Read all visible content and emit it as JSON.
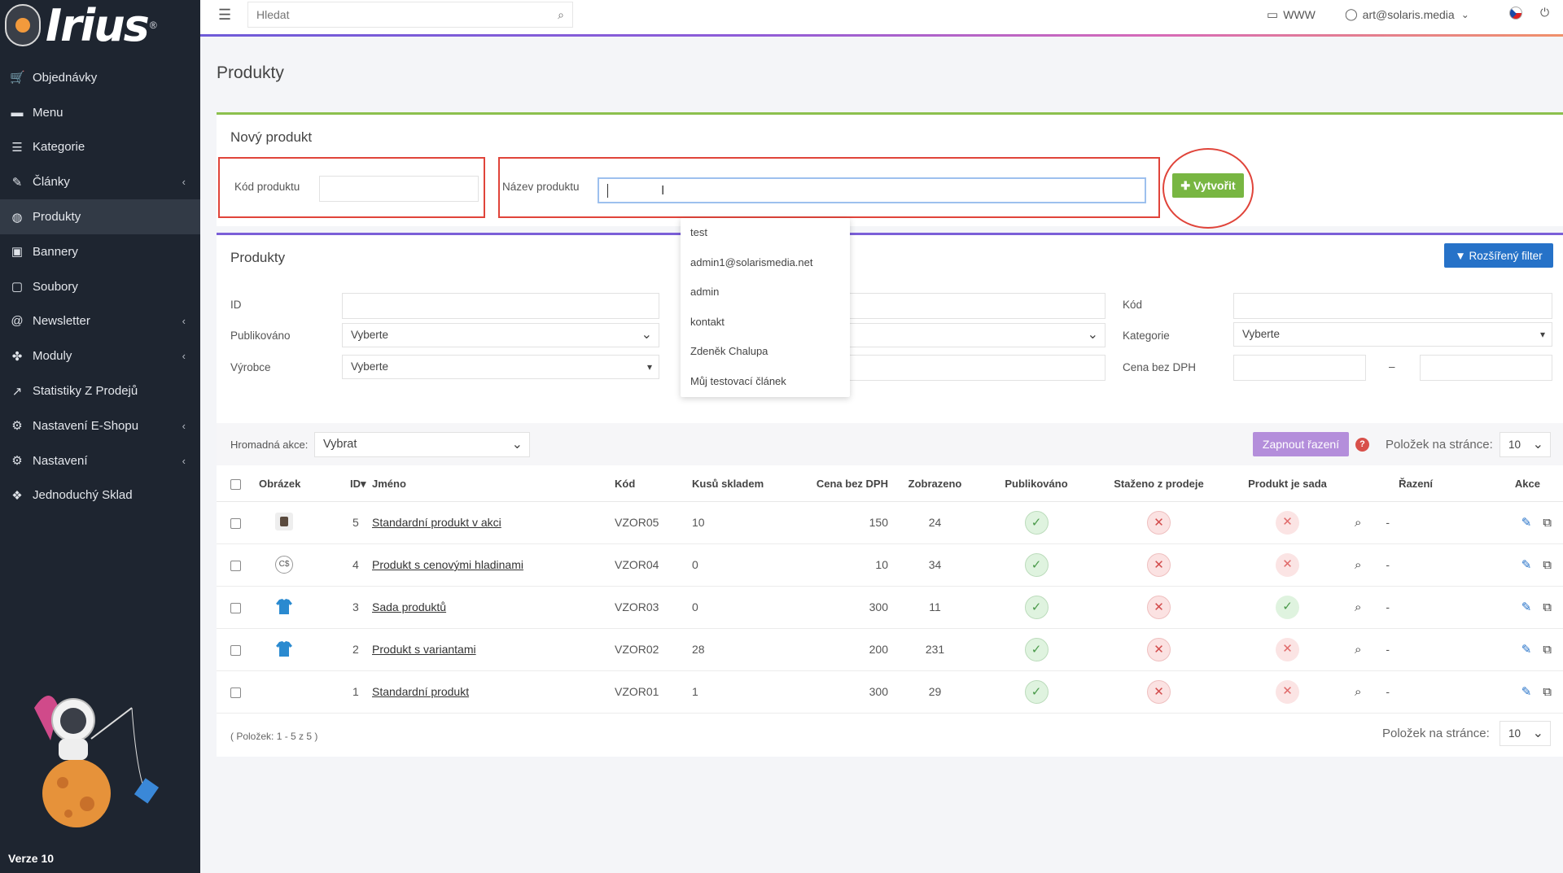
{
  "sidebar": {
    "logo_text": "Irius",
    "items": [
      {
        "label": "Objednávky",
        "icon": "cart-icon",
        "chevron": false
      },
      {
        "label": "Menu",
        "icon": "folder-icon",
        "chevron": false
      },
      {
        "label": "Kategorie",
        "icon": "list-icon",
        "chevron": false
      },
      {
        "label": "Články",
        "icon": "pencil-icon",
        "chevron": true
      },
      {
        "label": "Produkty",
        "icon": "globe-icon",
        "chevron": false,
        "active": true
      },
      {
        "label": "Bannery",
        "icon": "image-icon",
        "chevron": false
      },
      {
        "label": "Soubory",
        "icon": "file-icon",
        "chevron": false
      },
      {
        "label": "Newsletter",
        "icon": "mail-icon",
        "chevron": true
      },
      {
        "label": "Moduly",
        "icon": "puzzle-icon",
        "chevron": true
      },
      {
        "label": "Statistiky Z Prodejů",
        "icon": "chart-icon",
        "chevron": false
      },
      {
        "label": "Nastavení E-Shopu",
        "icon": "cogs-icon",
        "chevron": true
      },
      {
        "label": "Nastavení",
        "icon": "cogs-icon",
        "chevron": true
      },
      {
        "label": "Jednoduchý Sklad",
        "icon": "boxes-icon",
        "chevron": false
      }
    ],
    "version": "Verze 10"
  },
  "topbar": {
    "search_placeholder": "Hledat",
    "www_label": "WWW",
    "user_email": "art@solaris.media"
  },
  "page_title": "Produkty",
  "new_product": {
    "title": "Nový produkt",
    "code_label": "Kód produktu",
    "code_value": "",
    "name_label": "Název produktu",
    "name_value": "",
    "create_label": "Vytvořit",
    "autocomplete": [
      "test",
      "admin1@solarismedia.net",
      "admin",
      "kontakt",
      "Zdeněk Chalupa",
      "Můj testovací článek"
    ]
  },
  "filters": {
    "title": "Produkty",
    "extended_filter_label": "Rozšířený filter",
    "id_label": "ID",
    "published_label": "Publikováno",
    "published_value": "Vyberte",
    "manufacturer_label": "Výrobce",
    "manufacturer_value": "Vyberte",
    "code_label": "Kód",
    "category_label": "Kategorie",
    "category_value": "Vyberte",
    "price_label": "Cena bez DPH",
    "range_sep": "–"
  },
  "bulk": {
    "label": "Hromadná akce:",
    "value": "Vybrat",
    "sort_button": "Zapnout řazení",
    "help": "?",
    "per_page_label": "Položek na stránce:",
    "per_page_value": "10"
  },
  "table": {
    "headers": [
      "Obrázek",
      "ID",
      "Jméno",
      "Kód",
      "Kusů skladem",
      "Cena bez DPH",
      "Zobrazeno",
      "Publikováno",
      "Staženo z prodeje",
      "Produkt je sada",
      "Řazení",
      "Akce"
    ],
    "rows": [
      {
        "id": "5",
        "name": "Standardní produkt v akci",
        "code": "VZOR05",
        "stock": "10",
        "price": "150",
        "views": "24",
        "published": true,
        "withdrawn": false,
        "is_set": false,
        "order": "-",
        "thumb": "cup"
      },
      {
        "id": "4",
        "name": "Produkt s cenovými hladinami",
        "code": "VZOR04",
        "stock": "0",
        "price": "10",
        "views": "34",
        "published": true,
        "withdrawn": false,
        "is_set": false,
        "order": "-",
        "thumb": "coin"
      },
      {
        "id": "3",
        "name": "Sada produktů",
        "code": "VZOR03",
        "stock": "0",
        "price": "300",
        "views": "11",
        "published": true,
        "withdrawn": false,
        "is_set": true,
        "order": "-",
        "thumb": "shirt"
      },
      {
        "id": "2",
        "name": "Produkt s variantami",
        "code": "VZOR02",
        "stock": "28",
        "price": "200",
        "views": "231",
        "published": true,
        "withdrawn": false,
        "is_set": false,
        "order": "-",
        "thumb": "shirt"
      },
      {
        "id": "1",
        "name": "Standardní produkt",
        "code": "VZOR01",
        "stock": "1",
        "price": "300",
        "views": "29",
        "published": true,
        "withdrawn": false,
        "is_set": false,
        "order": "-",
        "thumb": "none"
      }
    ]
  },
  "footer": {
    "count_text": "( Položek: 1 - 5 z 5 )",
    "per_page_label": "Položek na stránce:",
    "per_page_value": "10"
  },
  "colors": {
    "sidebar_bg": "#1e2530",
    "create_green": "#78b642",
    "filter_blue": "#2672c8",
    "sort_purple": "#b48edb",
    "annotation_red": "#e0443a"
  }
}
